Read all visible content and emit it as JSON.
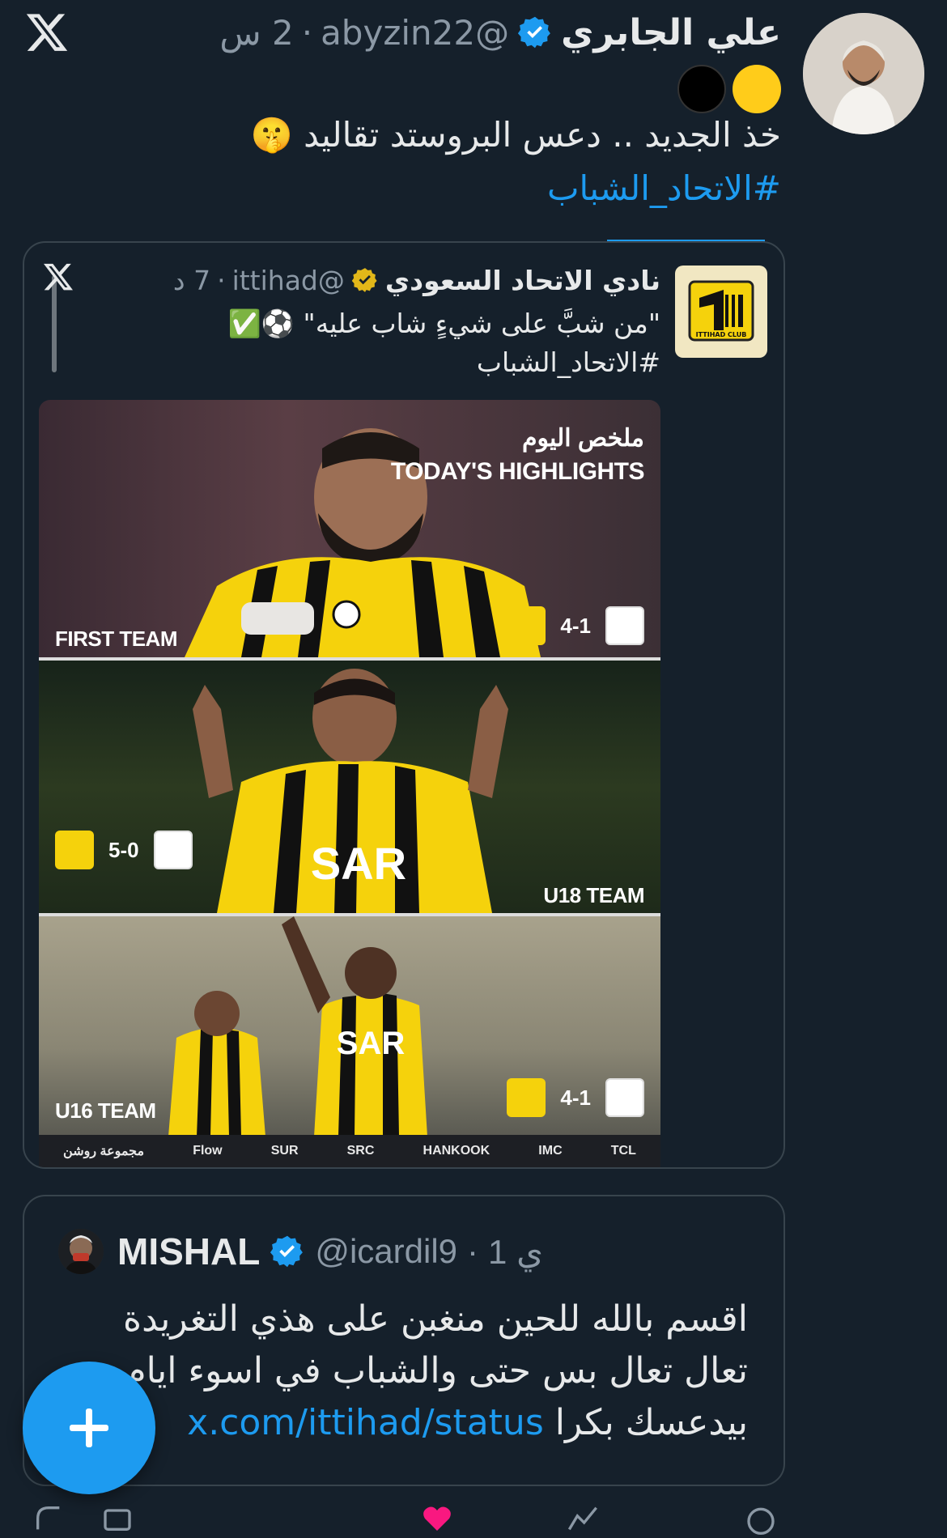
{
  "app": {
    "logo": "x-logo"
  },
  "tweet": {
    "author_name": "علي الجابري",
    "handle": "@abyzin22",
    "separator": "·",
    "time": "2 س",
    "verified": true,
    "emoji": [
      "yellow-circle",
      "black-circle"
    ],
    "text_line": "خذ الجديد .. دعس البروستد تقاليد 🤫",
    "hashtag": "#الاتحاد_الشباب"
  },
  "quoted": {
    "logo": "x-logo",
    "author_name": "نادي الاتحاد السعودي",
    "verified_badge": "gold",
    "handle": "@ittihad",
    "separator": "·",
    "time": "7 د",
    "text_line": "\"من شبَّ على شيءٍ شاب عليه\" ⚽️✅",
    "hashtag": "#الاتحاد_الشباب",
    "club_logo_text": "ITTIHAD CLUB",
    "media": {
      "title_ar": "ملخص اليوم",
      "title_en": "TODAY'S HIGHLIGHTS",
      "panels": [
        {
          "team": "FIRST TEAM",
          "score": "4-1"
        },
        {
          "team": "U18 TEAM",
          "score": "5-0"
        },
        {
          "team": "U16 TEAM",
          "score": "4-1"
        }
      ],
      "sponsors": [
        "مجموعة روشن",
        "Flow",
        "SUR",
        "SRC",
        "HANKOOK",
        "IMC",
        "TCL"
      ]
    }
  },
  "reply": {
    "name": "MISHAL",
    "verified": true,
    "handle": "@icardil9",
    "separator": "·",
    "time": "1 ي",
    "line1": "اقسم بالله للحين منغبن على هذي التغريدة",
    "line2": "تعال تعال بس حتى والشباب في اسوء ايام",
    "line3_text": "بيدعسك بكرا",
    "line3_link": "x.com/ittihad/status"
  },
  "fab": {
    "icon": "plus-icon"
  },
  "actions": [
    {
      "icon": "reply-icon",
      "count": ""
    },
    {
      "icon": "retweet-icon",
      "count": ""
    },
    {
      "icon": "heart-icon",
      "count": ""
    },
    {
      "icon": "views-icon",
      "count": ""
    }
  ],
  "colors": {
    "background": "#15202b",
    "accent": "#1d9bf0",
    "muted": "#8b98a5",
    "gold": "#f5d20c"
  }
}
